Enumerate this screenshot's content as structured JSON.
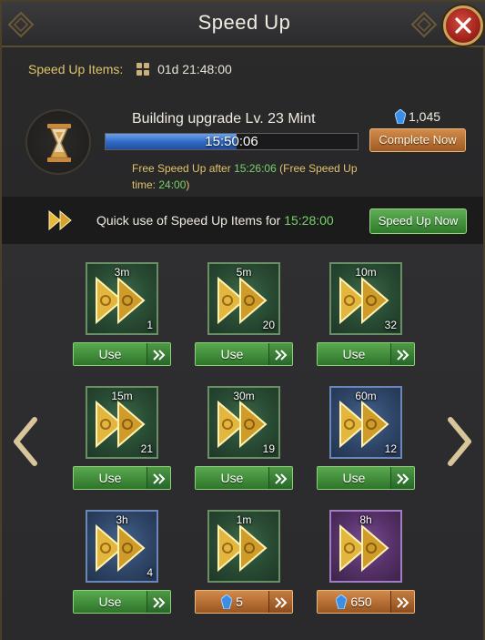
{
  "header": {
    "title": "Speed Up"
  },
  "speedup_items": {
    "label": "Speed Up Items:",
    "time": "01d 21:48:00"
  },
  "task": {
    "name": "Building upgrade Lv. 23 Mint",
    "remaining": "15:50:06",
    "progress_fraction": 0.52,
    "free_prefix": "Free Speed Up after ",
    "free_time": "15:26:06",
    "free_mid": " (Free Speed Up time: ",
    "free_limit": "24:00",
    "free_suffix": ")",
    "gems": "1,045",
    "complete_label": "Complete Now"
  },
  "quick": {
    "text": "Quick use of Speed Up Items for ",
    "time": "15:28:00",
    "button_label": "Speed Up Now"
  },
  "items": [
    {
      "duration": "3m",
      "count": "1",
      "rarity": "green",
      "action": "Use"
    },
    {
      "duration": "5m",
      "count": "20",
      "rarity": "green",
      "action": "Use"
    },
    {
      "duration": "10m",
      "count": "32",
      "rarity": "green",
      "action": "Use"
    },
    {
      "duration": "15m",
      "count": "21",
      "rarity": "green",
      "action": "Use"
    },
    {
      "duration": "30m",
      "count": "19",
      "rarity": "green",
      "action": "Use"
    },
    {
      "duration": "60m",
      "count": "12",
      "rarity": "blue",
      "action": "Use"
    },
    {
      "duration": "3h",
      "count": "4",
      "rarity": "blue",
      "action": "Use"
    },
    {
      "duration": "1m",
      "count": "",
      "rarity": "green",
      "action": "buy",
      "price": "5"
    },
    {
      "duration": "8h",
      "count": "",
      "rarity": "purple",
      "action": "buy",
      "price": "650"
    }
  ],
  "colors": {
    "accent_gold": "#e0c36a",
    "highlight_green": "#78d26a",
    "progress_blue": "#2e68c4"
  },
  "icons": [
    "close-icon",
    "grid-icon",
    "hourglass-icon",
    "gem-icon",
    "double-arrow-icon",
    "chevron-left-icon",
    "chevron-right-icon"
  ]
}
